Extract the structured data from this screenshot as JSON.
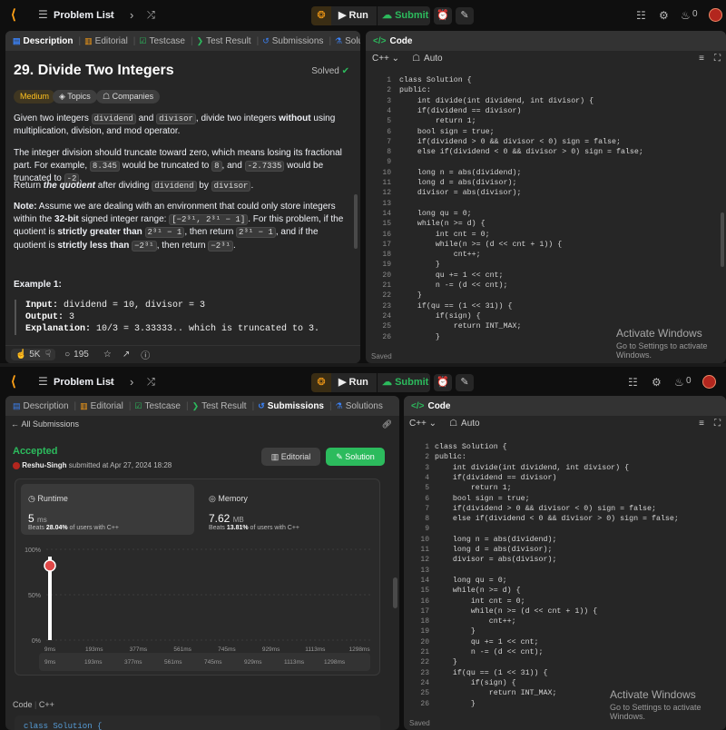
{
  "topbar": {
    "problem_list": "Problem List",
    "run": "Run",
    "submit": "Submit",
    "streak": "0"
  },
  "left_tabs": {
    "description": "Description",
    "editorial": "Editorial",
    "testcase": "Testcase",
    "test_result": "Test Result",
    "submissions": "Submissions",
    "solutions": "Solutions"
  },
  "problem": {
    "title": "29. Divide Two Integers",
    "status": "Solved",
    "difficulty": "Medium",
    "topics": "Topics",
    "companies": "Companies",
    "p1_a": "Given two integers ",
    "p1_code1": "dividend",
    "p1_b": " and ",
    "p1_code2": "divisor",
    "p1_c": ", divide two integers ",
    "p1_bold": "without",
    "p1_d": " using multiplication, division, and mod operator.",
    "p2_a": "The integer division should truncate toward zero, which means losing its fractional part. For example, ",
    "p2_code1": "8.345",
    "p2_b": " would be truncated to ",
    "p2_code2": "8",
    "p2_c": ", and ",
    "p2_code3": "-2.7335",
    "p2_d": " would be truncated to ",
    "p2_code4": "-2",
    "p2_e": ".",
    "p3_a": "Return ",
    "p3_em": "the quotient",
    "p3_b": " after dividing ",
    "p3_code1": "dividend",
    "p3_c": " by ",
    "p3_code2": "divisor",
    "p3_d": ".",
    "note_label": "Note:",
    "p4_a": " Assume we are dealing with an environment that could only store integers within the ",
    "p4_bold1": "32-bit",
    "p4_b": " signed integer range: ",
    "p4_code1": "[−2³¹, 2³¹ − 1]",
    "p4_c": ". For this problem, if the quotient is ",
    "p4_bold2": "strictly greater than",
    "p4_code2": "2³¹ − 1",
    "p4_d": ", then return ",
    "p4_code3": "2³¹ − 1",
    "p4_e": ", and if the quotient is ",
    "p4_bold3": "strictly less than",
    "p4_code4": "−2³¹",
    "p4_f": ", then return ",
    "p4_code5": "−2³¹",
    "p4_g": ".",
    "example_title": "Example 1:",
    "ex_input_label": "Input:",
    "ex_input": " dividend = 10, divisor = 3",
    "ex_output_label": "Output:",
    "ex_output": " 3",
    "ex_expl_label": "Explanation:",
    "ex_expl": " 10/3 = 3.33333.. which is truncated to 3.",
    "likes": "5K",
    "comments": "195"
  },
  "code_panel": {
    "title": "Code",
    "language": "C++",
    "auto": "Auto",
    "saved": "Saved",
    "lines": [
      "class Solution {",
      "public:",
      "    int divide(int dividend, int divisor) {",
      "    if(dividend == divisor)",
      "        return 1;",
      "    bool sign = true;",
      "    if(dividend > 0 && divisor < 0) sign = false;",
      "    else if(dividend < 0 && divisor > 0) sign = false;",
      "",
      "    long n = abs(dividend);",
      "    long d = abs(divisor);",
      "    divisor = abs(divisor);",
      "",
      "    long qu = 0;",
      "    while(n >= d) {",
      "        int cnt = 0;",
      "        while(n >= (d << cnt + 1)) {",
      "            cnt++;",
      "        }",
      "        qu += 1 << cnt;",
      "        n -= (d << cnt);",
      "    }",
      "    if(qu == (1 << 31)) {",
      "        if(sign) {",
      "            return INT_MAX;",
      "        }"
    ]
  },
  "watermark": {
    "title": "Activate Windows",
    "sub": "Go to Settings to activate Windows."
  },
  "submission": {
    "back": "All Submissions",
    "status": "Accepted",
    "user": "Reshu-Singh",
    "submitted_text": " submitted at Apr 27, 2024 18:28",
    "editorial_btn": "Editorial",
    "solution_btn": "Solution",
    "runtime_label": "Runtime",
    "runtime_value": "5",
    "runtime_unit": "ms",
    "runtime_beats_a": "Beats ",
    "runtime_beats_pct": "28.04%",
    "runtime_beats_b": " of users with C++",
    "memory_label": "Memory",
    "memory_value": "7.62",
    "memory_unit": "MB",
    "memory_beats_a": "Beats ",
    "memory_beats_pct": "13.81%",
    "memory_beats_b": " of users with C++",
    "code_label": "Code",
    "code_lang": "C++",
    "code_peek": "class Solution {"
  },
  "chart_data": {
    "type": "bar",
    "y_ticks": [
      "100%",
      "50%",
      "0%"
    ],
    "x_ticks": [
      "9ms",
      "193ms",
      "377ms",
      "561ms",
      "745ms",
      "929ms",
      "1113ms",
      "1298ms"
    ],
    "scrubber_ticks": [
      "9ms",
      "193ms",
      "377ms",
      "561ms",
      "745ms",
      "929ms",
      "1113ms",
      "1298ms"
    ],
    "highlight_x": "9ms",
    "highlight_value": 0.92,
    "grid": true,
    "colors": {
      "bar": "#ffffff",
      "marker": "#e04848"
    }
  },
  "colors": {
    "accent": "#ffa116",
    "green": "#2cbb5d",
    "panel": "#262626"
  }
}
